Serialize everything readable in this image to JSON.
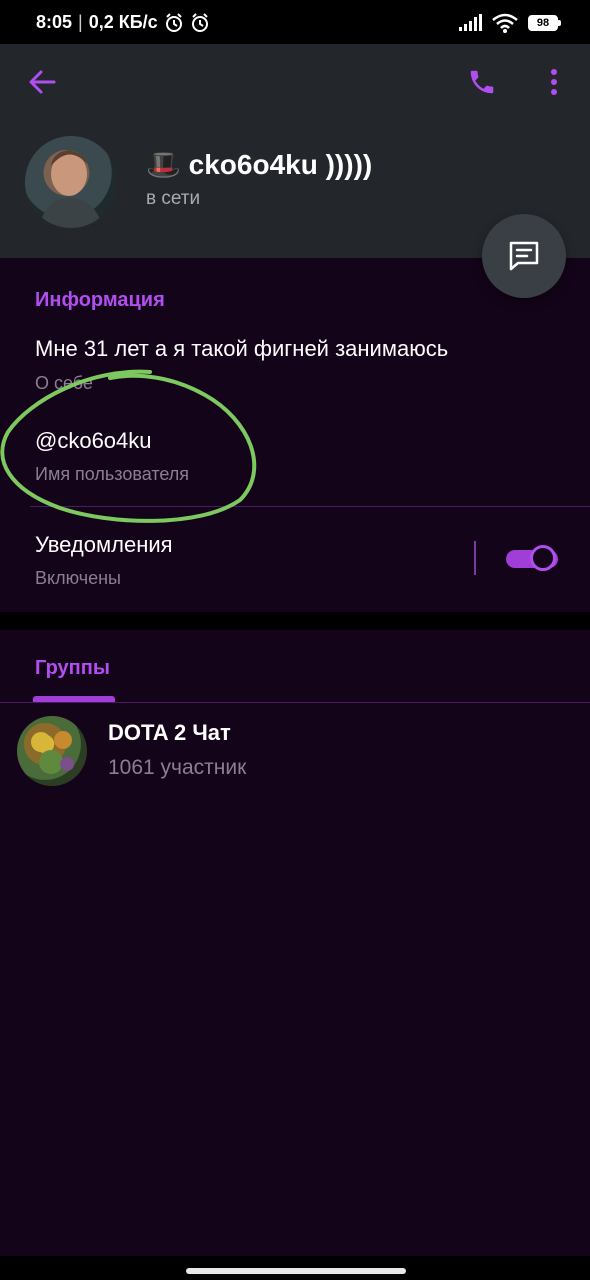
{
  "status_bar": {
    "time": "8:05",
    "speed": "0,2 КБ/с",
    "battery": "98"
  },
  "profile": {
    "name": "🎩 cko6o4ku )))))",
    "status": "в сети"
  },
  "info": {
    "title": "Информация",
    "bio_value": "Мне 31 лет а я такой фигней занимаюсь",
    "bio_label": "О себе",
    "username_value": "@cko6o4ku",
    "username_label": "Имя пользователя",
    "notifications_value": "Уведомления",
    "notifications_label": "Включены",
    "notifications_enabled": true
  },
  "groups": {
    "title": "Группы",
    "items": [
      {
        "name": "DOTA 2 Чат",
        "members": "1061 участник"
      }
    ]
  },
  "colors": {
    "accent": "#b14ef0",
    "header_bg": "#23272b",
    "content_bg": "#14041a",
    "annotation": "#7ec860"
  },
  "icons": {
    "back": "arrow-left-icon",
    "call": "phone-icon",
    "more": "more-vertical-icon",
    "message": "message-icon"
  }
}
